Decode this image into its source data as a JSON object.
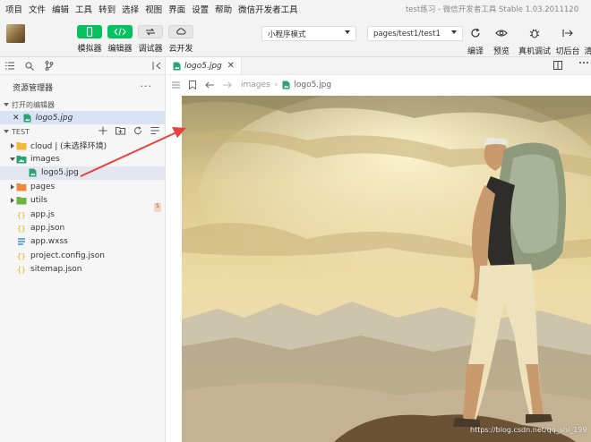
{
  "menu": {
    "items": [
      "项目",
      "文件",
      "编辑",
      "工具",
      "转到",
      "选择",
      "视图",
      "界面",
      "设置",
      "帮助",
      "微信开发者工具"
    ],
    "window_title": "test练习 - 微信开发者工具 Stable 1.03.2011120"
  },
  "toolbar": {
    "simulator_label": "模拟器",
    "editor_label": "编辑器",
    "debugger_label": "调试器",
    "cloud_label": "云开发",
    "mode_select": "小程序模式",
    "page_select": "pages/test1/test1",
    "compile_label": "编译",
    "preview_label": "预览",
    "device_debug_label": "真机调试",
    "background_label": "切后台",
    "clear_label": "清"
  },
  "explorer": {
    "title": "资源管理器",
    "more": "···",
    "open_editors_header": "打开的编辑器",
    "open_file": "logo5.jpg",
    "project_header": "TEST",
    "badge": "5",
    "tree": [
      {
        "label": "cloud | (未选择环境)",
        "type": "folder-cloud",
        "level": 0,
        "expanded": false
      },
      {
        "label": "images",
        "type": "folder-images",
        "level": 0,
        "expanded": true
      },
      {
        "label": "logo5.jpg",
        "type": "image",
        "level": 1,
        "selected": true
      },
      {
        "label": "pages",
        "type": "folder-pages",
        "level": 0,
        "expanded": false
      },
      {
        "label": "utils",
        "type": "folder-utils",
        "level": 0,
        "expanded": false
      },
      {
        "label": "app.js",
        "type": "js",
        "level": 0
      },
      {
        "label": "app.json",
        "type": "json",
        "level": 0
      },
      {
        "label": "app.wxss",
        "type": "wxss",
        "level": 0
      },
      {
        "label": "project.config.json",
        "type": "json",
        "level": 0
      },
      {
        "label": "sitemap.json",
        "type": "json",
        "level": 0
      }
    ]
  },
  "editor": {
    "tab_label": "logo5.jpg",
    "breadcrumb_folder": "images",
    "breadcrumb_file": "logo5.jpg"
  },
  "watermark": "https://blog.csdn.net/qq_shi_199",
  "colors": {
    "accent_green": "#07c160",
    "selection_blue": "#d6e4f5",
    "annotation_red": "#e8403a"
  }
}
